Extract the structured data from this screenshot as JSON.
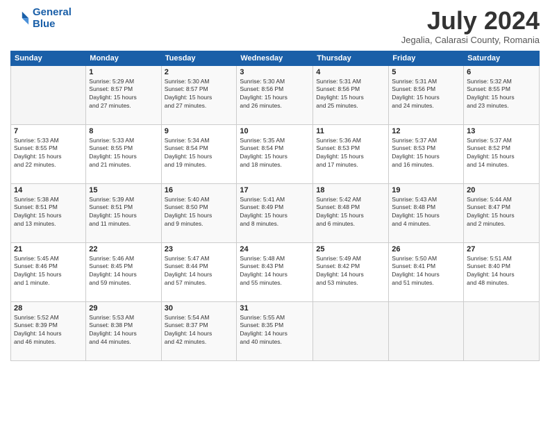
{
  "logo": {
    "line1": "General",
    "line2": "Blue"
  },
  "title": "July 2024",
  "location": "Jegalia, Calarasi County, Romania",
  "header_days": [
    "Sunday",
    "Monday",
    "Tuesday",
    "Wednesday",
    "Thursday",
    "Friday",
    "Saturday"
  ],
  "weeks": [
    [
      {
        "day": "",
        "info": ""
      },
      {
        "day": "1",
        "info": "Sunrise: 5:29 AM\nSunset: 8:57 PM\nDaylight: 15 hours\nand 27 minutes."
      },
      {
        "day": "2",
        "info": "Sunrise: 5:30 AM\nSunset: 8:57 PM\nDaylight: 15 hours\nand 27 minutes."
      },
      {
        "day": "3",
        "info": "Sunrise: 5:30 AM\nSunset: 8:56 PM\nDaylight: 15 hours\nand 26 minutes."
      },
      {
        "day": "4",
        "info": "Sunrise: 5:31 AM\nSunset: 8:56 PM\nDaylight: 15 hours\nand 25 minutes."
      },
      {
        "day": "5",
        "info": "Sunrise: 5:31 AM\nSunset: 8:56 PM\nDaylight: 15 hours\nand 24 minutes."
      },
      {
        "day": "6",
        "info": "Sunrise: 5:32 AM\nSunset: 8:55 PM\nDaylight: 15 hours\nand 23 minutes."
      }
    ],
    [
      {
        "day": "7",
        "info": "Sunrise: 5:33 AM\nSunset: 8:55 PM\nDaylight: 15 hours\nand 22 minutes."
      },
      {
        "day": "8",
        "info": "Sunrise: 5:33 AM\nSunset: 8:55 PM\nDaylight: 15 hours\nand 21 minutes."
      },
      {
        "day": "9",
        "info": "Sunrise: 5:34 AM\nSunset: 8:54 PM\nDaylight: 15 hours\nand 19 minutes."
      },
      {
        "day": "10",
        "info": "Sunrise: 5:35 AM\nSunset: 8:54 PM\nDaylight: 15 hours\nand 18 minutes."
      },
      {
        "day": "11",
        "info": "Sunrise: 5:36 AM\nSunset: 8:53 PM\nDaylight: 15 hours\nand 17 minutes."
      },
      {
        "day": "12",
        "info": "Sunrise: 5:37 AM\nSunset: 8:53 PM\nDaylight: 15 hours\nand 16 minutes."
      },
      {
        "day": "13",
        "info": "Sunrise: 5:37 AM\nSunset: 8:52 PM\nDaylight: 15 hours\nand 14 minutes."
      }
    ],
    [
      {
        "day": "14",
        "info": "Sunrise: 5:38 AM\nSunset: 8:51 PM\nDaylight: 15 hours\nand 13 minutes."
      },
      {
        "day": "15",
        "info": "Sunrise: 5:39 AM\nSunset: 8:51 PM\nDaylight: 15 hours\nand 11 minutes."
      },
      {
        "day": "16",
        "info": "Sunrise: 5:40 AM\nSunset: 8:50 PM\nDaylight: 15 hours\nand 9 minutes."
      },
      {
        "day": "17",
        "info": "Sunrise: 5:41 AM\nSunset: 8:49 PM\nDaylight: 15 hours\nand 8 minutes."
      },
      {
        "day": "18",
        "info": "Sunrise: 5:42 AM\nSunset: 8:48 PM\nDaylight: 15 hours\nand 6 minutes."
      },
      {
        "day": "19",
        "info": "Sunrise: 5:43 AM\nSunset: 8:48 PM\nDaylight: 15 hours\nand 4 minutes."
      },
      {
        "day": "20",
        "info": "Sunrise: 5:44 AM\nSunset: 8:47 PM\nDaylight: 15 hours\nand 2 minutes."
      }
    ],
    [
      {
        "day": "21",
        "info": "Sunrise: 5:45 AM\nSunset: 8:46 PM\nDaylight: 15 hours\nand 1 minute."
      },
      {
        "day": "22",
        "info": "Sunrise: 5:46 AM\nSunset: 8:45 PM\nDaylight: 14 hours\nand 59 minutes."
      },
      {
        "day": "23",
        "info": "Sunrise: 5:47 AM\nSunset: 8:44 PM\nDaylight: 14 hours\nand 57 minutes."
      },
      {
        "day": "24",
        "info": "Sunrise: 5:48 AM\nSunset: 8:43 PM\nDaylight: 14 hours\nand 55 minutes."
      },
      {
        "day": "25",
        "info": "Sunrise: 5:49 AM\nSunset: 8:42 PM\nDaylight: 14 hours\nand 53 minutes."
      },
      {
        "day": "26",
        "info": "Sunrise: 5:50 AM\nSunset: 8:41 PM\nDaylight: 14 hours\nand 51 minutes."
      },
      {
        "day": "27",
        "info": "Sunrise: 5:51 AM\nSunset: 8:40 PM\nDaylight: 14 hours\nand 48 minutes."
      }
    ],
    [
      {
        "day": "28",
        "info": "Sunrise: 5:52 AM\nSunset: 8:39 PM\nDaylight: 14 hours\nand 46 minutes."
      },
      {
        "day": "29",
        "info": "Sunrise: 5:53 AM\nSunset: 8:38 PM\nDaylight: 14 hours\nand 44 minutes."
      },
      {
        "day": "30",
        "info": "Sunrise: 5:54 AM\nSunset: 8:37 PM\nDaylight: 14 hours\nand 42 minutes."
      },
      {
        "day": "31",
        "info": "Sunrise: 5:55 AM\nSunset: 8:35 PM\nDaylight: 14 hours\nand 40 minutes."
      },
      {
        "day": "",
        "info": ""
      },
      {
        "day": "",
        "info": ""
      },
      {
        "day": "",
        "info": ""
      }
    ]
  ]
}
